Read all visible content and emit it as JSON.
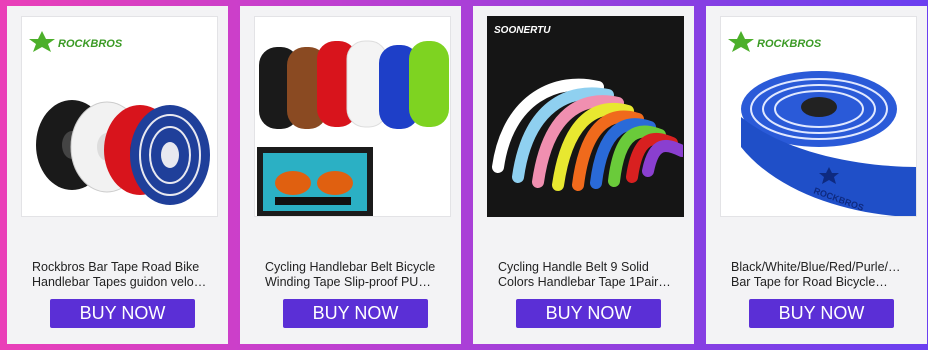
{
  "products": [
    {
      "brand": "ROCKBROS",
      "title_line1": "Rockbros Bar Tape Road Bike",
      "title_line2": "Handlebar Tapes guidon velo…",
      "button": "BUY NOW",
      "image_icon": "handlebar-tape-rolls-image"
    },
    {
      "brand": "",
      "title_line1": "Cycling Handlebar Belt Bicycle",
      "title_line2": "Winding Tape Slip-proof PU…",
      "button": "BUY NOW",
      "image_icon": "colorful-tape-rolls-image"
    },
    {
      "brand": "SOONERTU",
      "title_line1": "Cycling Handle Belt 9 Solid",
      "title_line2": "Colors Handlebar Tape 1Pair…",
      "button": "BUY NOW",
      "image_icon": "handlebars-with-tape-image"
    },
    {
      "brand": "ROCKBROS",
      "title_line1": "Black/White/Blue/Red/Purle/…",
      "title_line2": "Bar Tape for Road Bicycle…",
      "button": "BUY NOW",
      "image_icon": "blue-tape-roll-image"
    }
  ],
  "colors": {
    "button": "#5b2fd6",
    "card_bg": "#f3f3f5",
    "background_start": "#ea3fb8",
    "background_end": "#6a3ff0"
  }
}
